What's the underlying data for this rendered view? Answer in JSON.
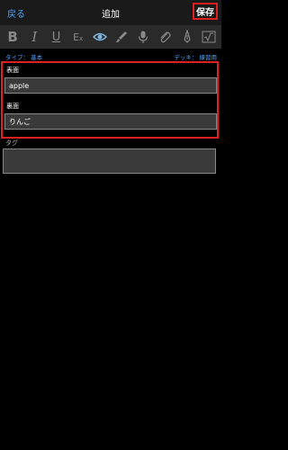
{
  "nav": {
    "back": "戻る",
    "title": "追加",
    "save": "保存"
  },
  "toolbar": {
    "bold": "B",
    "italic": "I",
    "underline": "U",
    "clear_format": "E",
    "clear_format_sub": "x",
    "icons": [
      "bold-icon",
      "italic-icon",
      "underline-icon",
      "clear-format-icon",
      "eye-icon",
      "brush-icon",
      "microphone-icon",
      "attachment-icon",
      "pen-icon",
      "math-icon"
    ],
    "active_color": "#7fb8e0",
    "inactive_color": "#8a8a8a"
  },
  "meta": {
    "type": "タイプ： 基本",
    "deck": "デッキ： 練習用"
  },
  "fields": [
    {
      "label": "表面",
      "value": "apple"
    },
    {
      "label": "裏面",
      "value": "りんご"
    }
  ],
  "tags": {
    "label": "タグ",
    "value": ""
  },
  "colors": {
    "accent": "#4da3ff",
    "highlight": "#e02020",
    "background": "#000000"
  }
}
